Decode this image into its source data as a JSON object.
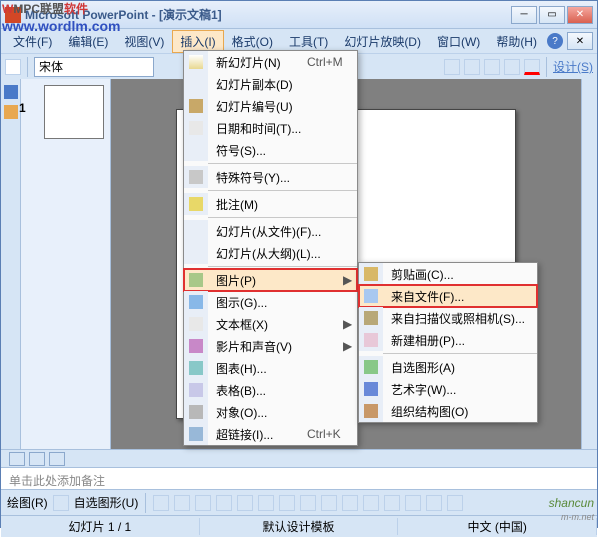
{
  "window": {
    "title": "Microsoft PowerPoint - [演示文稿1]"
  },
  "watermarks": {
    "w1_a": "W",
    "w1_b": "MPC联盟",
    "w1_c": "软件",
    "w2": "www.wordlm.com",
    "w3": "shancun",
    "w3_sub": "m-m.net"
  },
  "menubar": {
    "items": [
      "文件(F)",
      "编辑(E)",
      "视图(V)",
      "插入(I)",
      "格式(O)",
      "工具(T)",
      "幻灯片放映(D)",
      "窗口(W)",
      "帮助(H)"
    ]
  },
  "toolbar": {
    "font": "宋体",
    "design": "设计(S)"
  },
  "slide_panel": {
    "num": "1"
  },
  "notes": {
    "placeholder": "单击此处添加备注"
  },
  "bottom_toolbar": {
    "draw": "绘图(R)",
    "autoshape": "自选图形(U)"
  },
  "statusbar": {
    "slide": "幻灯片 1 / 1",
    "template": "默认设计模板",
    "lang": "中文 (中国)"
  },
  "insert_menu": {
    "items": [
      {
        "label": "新幻灯片(N)",
        "shortcut": "Ctrl+M",
        "icon": "ico-new"
      },
      {
        "label": "幻灯片副本(D)"
      },
      {
        "label": "幻灯片编号(U)",
        "icon": "ico-num"
      },
      {
        "label": "日期和时间(T)...",
        "icon": "ico-date"
      },
      {
        "label": "符号(S)..."
      },
      {
        "sep": true
      },
      {
        "label": "特殊符号(Y)...",
        "icon": "ico-sym"
      },
      {
        "sep": true
      },
      {
        "label": "批注(M)",
        "icon": "ico-note"
      },
      {
        "sep": true
      },
      {
        "label": "幻灯片(从文件)(F)..."
      },
      {
        "label": "幻灯片(从大纲)(L)..."
      },
      {
        "sep": true
      },
      {
        "label": "图片(P)",
        "icon": "ico-pic",
        "arrow": true,
        "highlighted": true,
        "redbox": true
      },
      {
        "label": "图示(G)...",
        "icon": "ico-dia"
      },
      {
        "label": "文本框(X)",
        "icon": "ico-txt",
        "arrow": true
      },
      {
        "label": "影片和声音(V)",
        "icon": "ico-mov",
        "arrow": true
      },
      {
        "label": "图表(H)...",
        "icon": "ico-chart"
      },
      {
        "label": "表格(B)...",
        "icon": "ico-tbl"
      },
      {
        "label": "对象(O)...",
        "icon": "ico-obj"
      },
      {
        "label": "超链接(I)...",
        "shortcut": "Ctrl+K",
        "icon": "ico-link"
      }
    ]
  },
  "picture_submenu": {
    "items": [
      {
        "label": "剪贴画(C)...",
        "icon": "ico-clip"
      },
      {
        "label": "来自文件(F)...",
        "icon": "ico-file",
        "highlighted": true,
        "redbox": true
      },
      {
        "label": "来自扫描仪或照相机(S)...",
        "icon": "ico-scan"
      },
      {
        "label": "新建相册(P)...",
        "icon": "ico-album"
      },
      {
        "sep": true
      },
      {
        "label": "自选图形(A)",
        "icon": "ico-shape"
      },
      {
        "label": "艺术字(W)...",
        "icon": "ico-art"
      },
      {
        "label": "组织结构图(O)",
        "icon": "ico-org"
      }
    ]
  }
}
